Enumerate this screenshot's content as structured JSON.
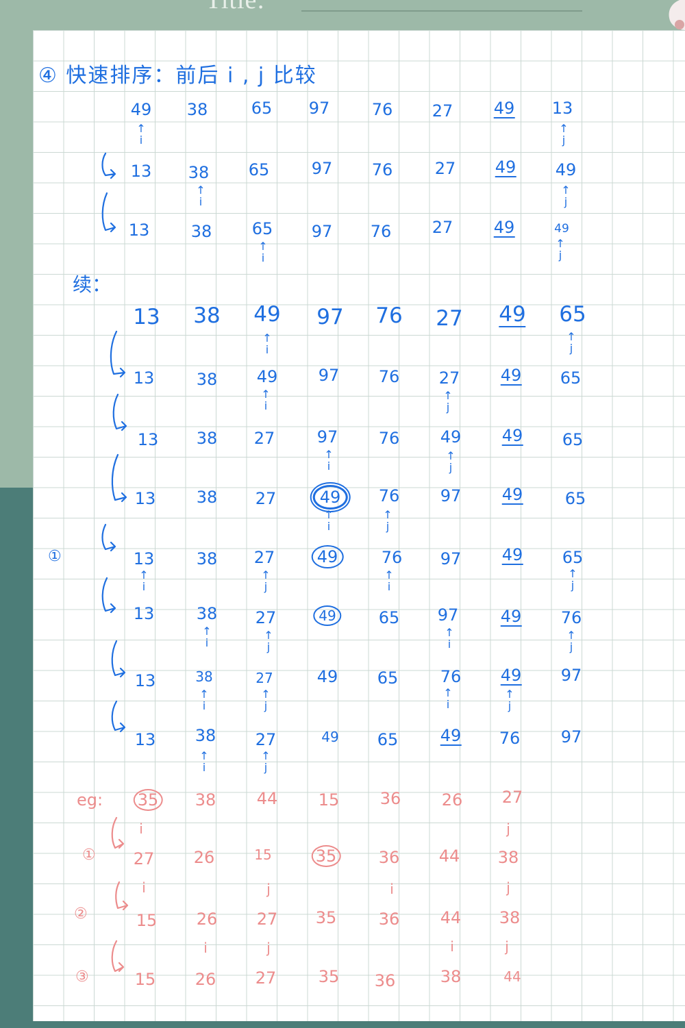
{
  "header": {
    "title_label": "Title:"
  },
  "heading": "④ 快速排序：前后 i , j 比较",
  "continue_label": "续：",
  "colors": {
    "blue_ink": "#1f6fe0",
    "red_ink": "#ec8c8c",
    "grid": "#cbd8d3"
  },
  "blue_rows": [
    {
      "values": [
        "49",
        "38",
        "65",
        "97",
        "76",
        "27",
        "49",
        "13"
      ]
    },
    {
      "values": [
        "13",
        "38",
        "65",
        "97",
        "76",
        "27",
        "49",
        "49"
      ]
    },
    {
      "values": [
        "13",
        "38",
        "65",
        "97",
        "76",
        "27",
        "49",
        "49"
      ]
    },
    {
      "values": [
        "13",
        "38",
        "49",
        "97",
        "76",
        "27",
        "49",
        "65"
      ]
    },
    {
      "values": [
        "13",
        "38",
        "49",
        "97",
        "76",
        "27",
        "49",
        "65"
      ]
    },
    {
      "values": [
        "13",
        "38",
        "27",
        "97",
        "76",
        "49",
        "49",
        "65"
      ]
    },
    {
      "values": [
        "13",
        "38",
        "27",
        "49",
        "76",
        "97",
        "49",
        "65"
      ]
    },
    {
      "values": [
        "13",
        "38",
        "27",
        "49",
        "76",
        "97",
        "49",
        "65"
      ]
    },
    {
      "values": [
        "13",
        "38",
        "27",
        "49",
        "65",
        "97",
        "49",
        "76"
      ]
    },
    {
      "values": [
        "13",
        "38",
        "27",
        "49",
        "65",
        "76",
        "49",
        "97"
      ]
    },
    {
      "values": [
        "13",
        "38",
        "27",
        "49",
        "65",
        "49",
        "76",
        "97"
      ]
    }
  ],
  "pass_marker_blue": "①",
  "example": {
    "label": "eg:",
    "rows": [
      {
        "marker": "",
        "values": [
          "35",
          "38",
          "44",
          "15",
          "36",
          "26",
          "27"
        ]
      },
      {
        "marker": "①",
        "values": [
          "27",
          "26",
          "15",
          "35",
          "36",
          "44",
          "38"
        ]
      },
      {
        "marker": "②",
        "values": [
          "15",
          "26",
          "27",
          "35",
          "36",
          "44",
          "38"
        ]
      },
      {
        "marker": "③",
        "values": [
          "15",
          "26",
          "27",
          "35",
          "36",
          "38",
          "44"
        ]
      }
    ]
  },
  "pointers": {
    "i": "i",
    "j": "j",
    "up_i": "↑\ni",
    "up_j": "↑\nj"
  }
}
